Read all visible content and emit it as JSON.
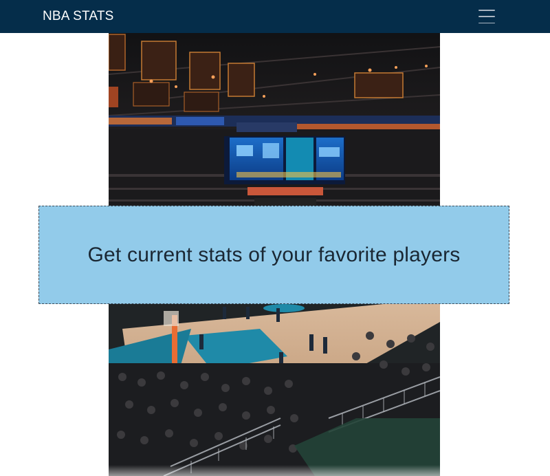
{
  "navbar": {
    "brand": "NBA STATS",
    "menu_icon": "hamburger-menu-icon",
    "background": "#052d4a"
  },
  "hero": {
    "image_alt": "arena"
  },
  "callout": {
    "heading": "Get current stats of your favorite players",
    "background": "#92cbea"
  }
}
